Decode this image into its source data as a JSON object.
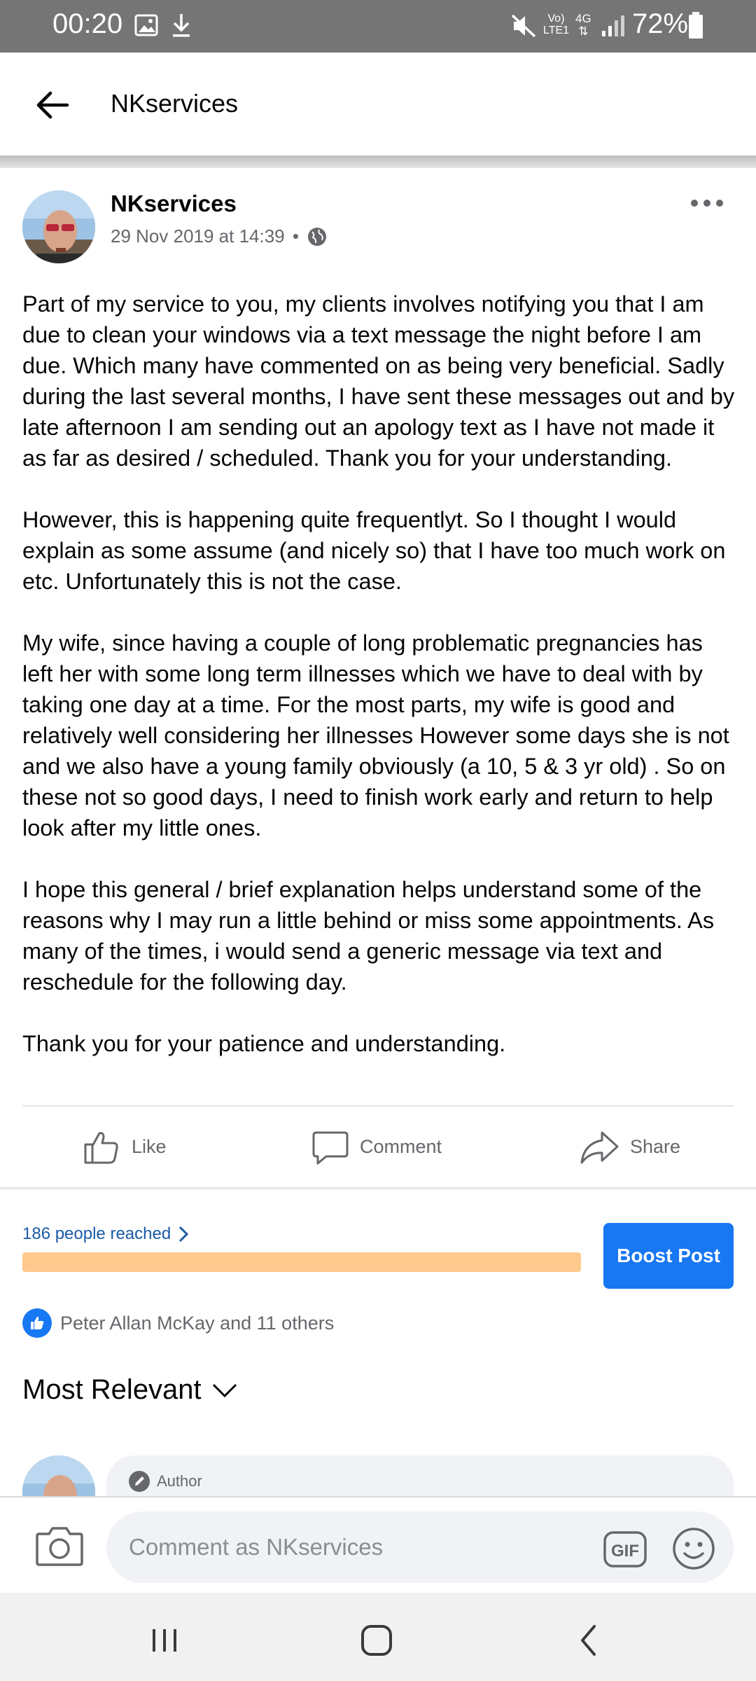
{
  "status_bar": {
    "time": "00:20",
    "network_line1": "Vo)",
    "network_line2": "LTE1",
    "generation": "4G",
    "battery_percent": "72%",
    "icons": [
      "image-icon",
      "download-icon",
      "mute-icon",
      "signal-icon",
      "battery-icon"
    ]
  },
  "header": {
    "title": "NKservices"
  },
  "post": {
    "author": "NKservices",
    "date": "29 Nov 2019 at 14:39",
    "separator": "•",
    "privacy_icon": "globe-icon",
    "paragraphs": [
      "Part of my service to you, my clients involves notifying you that I am due to clean your windows via a text message the night before I am due.  Which many have commented on as being very beneficial. Sadly during the last several months, I have sent these messages out and by late afternoon I am sending out an apology text as I have not made it as far as desired / scheduled.  Thank you for your understanding.",
      "However, this is happening quite frequentlyt.  So I thought I would explain as some assume (and nicely so) that I have too much work on etc.  Unfortunately this is not the case.",
      "My wife, since having a couple of long problematic pregnancies has left her with some long term illnesses which we have to deal with by taking one day at a time. For the most parts, my wife is good and relatively well considering her illnesses  However some days she is not and we also have a young family obviously (a 10, 5 & 3 yr old) .  So on these not so good days, I need to finish work early and return to help look after my little ones.",
      "I hope this general / brief explanation helps understand some of the reasons why I may run a little behind or miss some appointments. As many of the times, i would send a generic message via text and reschedule for the following day.",
      "Thank you for your patience and understanding."
    ]
  },
  "actions": {
    "like": "Like",
    "comment": "Comment",
    "share": "Share"
  },
  "insights": {
    "reach_label": "186 people reached",
    "boost_label": "Boost Post",
    "accent_color": "#1877f2",
    "reach_bar_color": "#ffc98d"
  },
  "reactions": {
    "summary": "Peter Allan McKay and 11 others"
  },
  "comments": {
    "sort_label": "Most Relevant",
    "first_comment": {
      "badge": "Author"
    }
  },
  "composer": {
    "placeholder": "Comment as NKservices",
    "gif_label": "GIF"
  }
}
